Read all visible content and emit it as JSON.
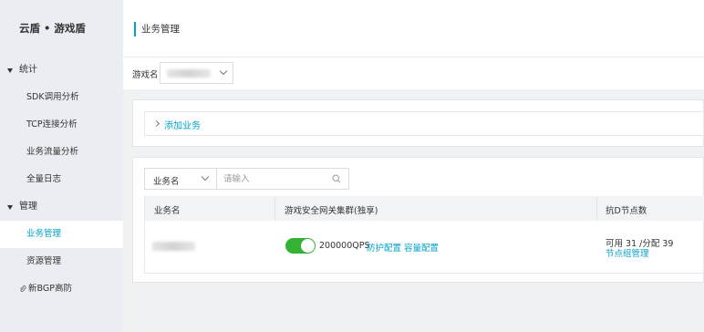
{
  "sidebar": {
    "brand": "云盾 • 游戏盾",
    "groups": [
      {
        "label": "统计",
        "items": [
          "SDK调用分析",
          "TCP连接分析",
          "业务流量分析",
          "全量日志"
        ]
      },
      {
        "label": "管理",
        "items": [
          "业务管理",
          "资源管理"
        ]
      }
    ],
    "active": "业务管理",
    "bgp": "新BGP高防"
  },
  "header": {
    "title": "业务管理"
  },
  "game_filter": {
    "label": "游戏名",
    "value": ""
  },
  "add_service": {
    "label": "添加业务"
  },
  "search": {
    "select_label": "业务名",
    "placeholder": "请输入"
  },
  "table": {
    "headers": [
      "业务名",
      "游戏安全网关集群(独享)",
      "抗D节点数"
    ],
    "rows": [
      {
        "name": "",
        "toggle_on": true,
        "qps": "200000QPS",
        "protect_link": "防护配置",
        "capacity_link": "容量配置",
        "nodes": "可用 31 /分配 39",
        "node_link": "节点组管理"
      }
    ]
  },
  "colors": {
    "accent": "#00a2ca",
    "toggle": "#34b234",
    "sidebar_bg": "#eaedf1"
  }
}
